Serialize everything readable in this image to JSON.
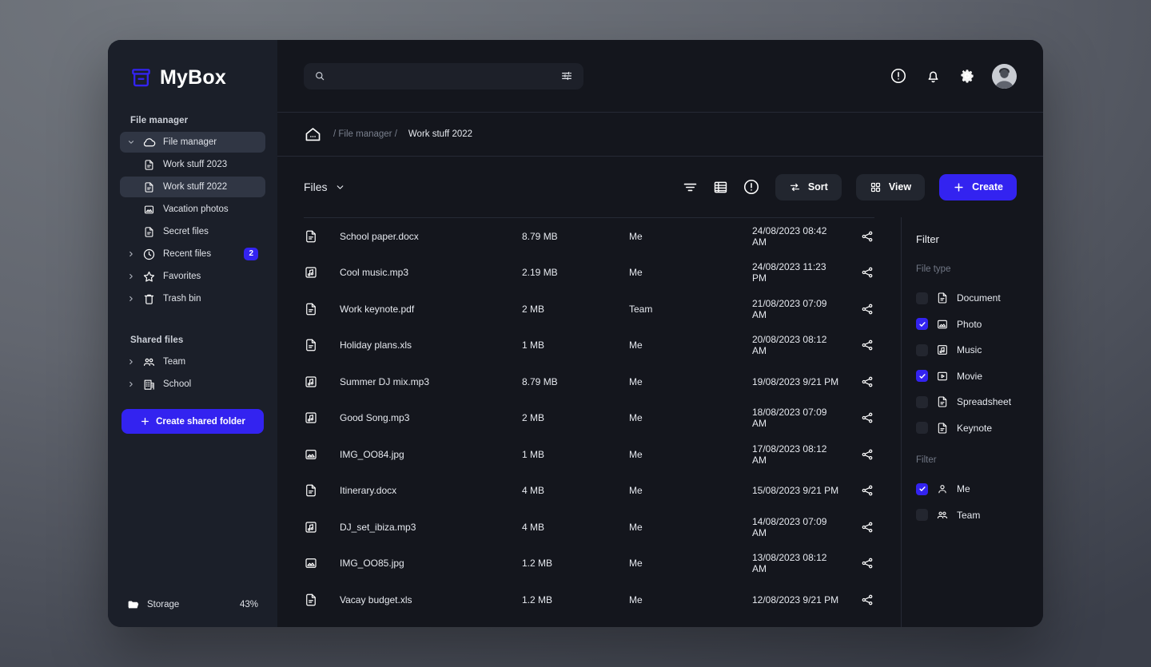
{
  "brand": {
    "title": "MyBox",
    "logo_icon": "archive-box-icon",
    "accent": "#3323f0"
  },
  "sidebar": {
    "section_file_manager": "File manager",
    "section_shared_files": "Shared files",
    "items": [
      {
        "label": "File manager",
        "icon": "cloud-icon",
        "expandable": true,
        "active": true,
        "child": false
      },
      {
        "label": "Work stuff 2023",
        "icon": "document-icon",
        "expandable": false,
        "active": false,
        "child": true
      },
      {
        "label": "Work stuff 2022",
        "icon": "document-icon",
        "expandable": false,
        "active": true,
        "child": true
      },
      {
        "label": "Vacation photos",
        "icon": "photo-icon",
        "expandable": false,
        "active": false,
        "child": true
      },
      {
        "label": "Secret files",
        "icon": "document-icon",
        "expandable": false,
        "active": false,
        "child": true
      },
      {
        "label": "Recent files",
        "icon": "clock-icon",
        "expandable": true,
        "active": false,
        "child": false,
        "badge": "2"
      },
      {
        "label": "Favorites",
        "icon": "star-icon",
        "expandable": true,
        "active": false,
        "child": false
      },
      {
        "label": "Trash bin",
        "icon": "trash-icon",
        "expandable": true,
        "active": false,
        "child": false
      }
    ],
    "shared_items": [
      {
        "label": "Team",
        "icon": "people-icon",
        "expandable": true
      },
      {
        "label": "School",
        "icon": "building-icon",
        "expandable": true
      }
    ],
    "create_shared_folder_label": "Create shared folder",
    "storage_label": "Storage",
    "storage_percent": "43%",
    "storage_icon": "folder-icon"
  },
  "topbar": {
    "search_placeholder": "",
    "search_value": "",
    "search_icon": "search-icon",
    "filter_sliders_icon": "sliders-icon",
    "icons": [
      "info-circle-icon",
      "bell-icon",
      "gear-icon"
    ],
    "avatar_name": "user-avatar"
  },
  "breadcrumb": {
    "home_icon": "home-icon",
    "path": "/ File manager /",
    "current": "Work stuff 2022"
  },
  "toolbar": {
    "files_label": "Files",
    "files_caret_icon": "chevron-down-icon",
    "icons": [
      "filter-icon",
      "list-view-icon",
      "info-circle-icon"
    ],
    "sort_label": "Sort",
    "sort_icon": "sort-arrows-icon",
    "view_label": "View",
    "view_icon": "grid-icon",
    "create_label": "Create",
    "create_icon": "plus-icon"
  },
  "files": [
    {
      "icon": "document-icon",
      "name": "School paper.docx",
      "size": "8.79 MB",
      "owner": "Me",
      "date": "24/08/2023 08:42 AM",
      "share_icon": "share-icon"
    },
    {
      "icon": "music-icon",
      "name": "Cool music.mp3",
      "size": "2.19 MB",
      "owner": "Me",
      "date": "24/08/2023 11:23 PM",
      "share_icon": "share-icon"
    },
    {
      "icon": "document-icon",
      "name": "Work keynote.pdf",
      "size": "2 MB",
      "owner": "Team",
      "date": "21/08/2023 07:09 AM",
      "share_icon": "share-icon"
    },
    {
      "icon": "document-icon",
      "name": "Holiday plans.xls",
      "size": "1 MB",
      "owner": "Me",
      "date": "20/08/2023 08:12 AM",
      "share_icon": "share-icon"
    },
    {
      "icon": "music-icon",
      "name": "Summer DJ mix.mp3",
      "size": "8.79 MB",
      "owner": "Me",
      "date": "19/08/2023 9/21 PM",
      "share_icon": "share-icon"
    },
    {
      "icon": "music-icon",
      "name": "Good Song.mp3",
      "size": "2 MB",
      "owner": "Me",
      "date": "18/08/2023 07:09 AM",
      "share_icon": "share-icon"
    },
    {
      "icon": "photo-icon",
      "name": "IMG_OO84.jpg",
      "size": "1 MB",
      "owner": "Me",
      "date": "17/08/2023 08:12 AM",
      "share_icon": "share-icon"
    },
    {
      "icon": "document-icon",
      "name": "Itinerary.docx",
      "size": "4 MB",
      "owner": "Me",
      "date": "15/08/2023 9/21 PM",
      "share_icon": "share-icon"
    },
    {
      "icon": "music-icon",
      "name": "DJ_set_ibiza.mp3",
      "size": "4 MB",
      "owner": "Me",
      "date": "14/08/2023 07:09 AM",
      "share_icon": "share-icon"
    },
    {
      "icon": "photo-icon",
      "name": "IMG_OO85.jpg",
      "size": "1.2 MB",
      "owner": "Me",
      "date": "13/08/2023 08:12 AM",
      "share_icon": "share-icon"
    },
    {
      "icon": "document-icon",
      "name": "Vacay budget.xls",
      "size": "1.2 MB",
      "owner": "Me",
      "date": "12/08/2023 9/21 PM",
      "share_icon": "share-icon"
    }
  ],
  "filter_panel": {
    "title": "Filter",
    "file_type_label": "File type",
    "file_types": [
      {
        "label": "Document",
        "icon": "document-icon",
        "checked": false
      },
      {
        "label": "Photo",
        "icon": "photo-icon",
        "checked": true
      },
      {
        "label": "Music",
        "icon": "music-icon",
        "checked": false
      },
      {
        "label": "Movie",
        "icon": "movie-icon",
        "checked": true
      },
      {
        "label": "Spreadsheet",
        "icon": "document-icon",
        "checked": false
      },
      {
        "label": "Keynote",
        "icon": "document-icon",
        "checked": false
      }
    ],
    "owner_label": "Filter",
    "owners": [
      {
        "label": "Me",
        "icon": "person-icon",
        "checked": true
      },
      {
        "label": "Team",
        "icon": "people-icon",
        "checked": false
      }
    ]
  }
}
